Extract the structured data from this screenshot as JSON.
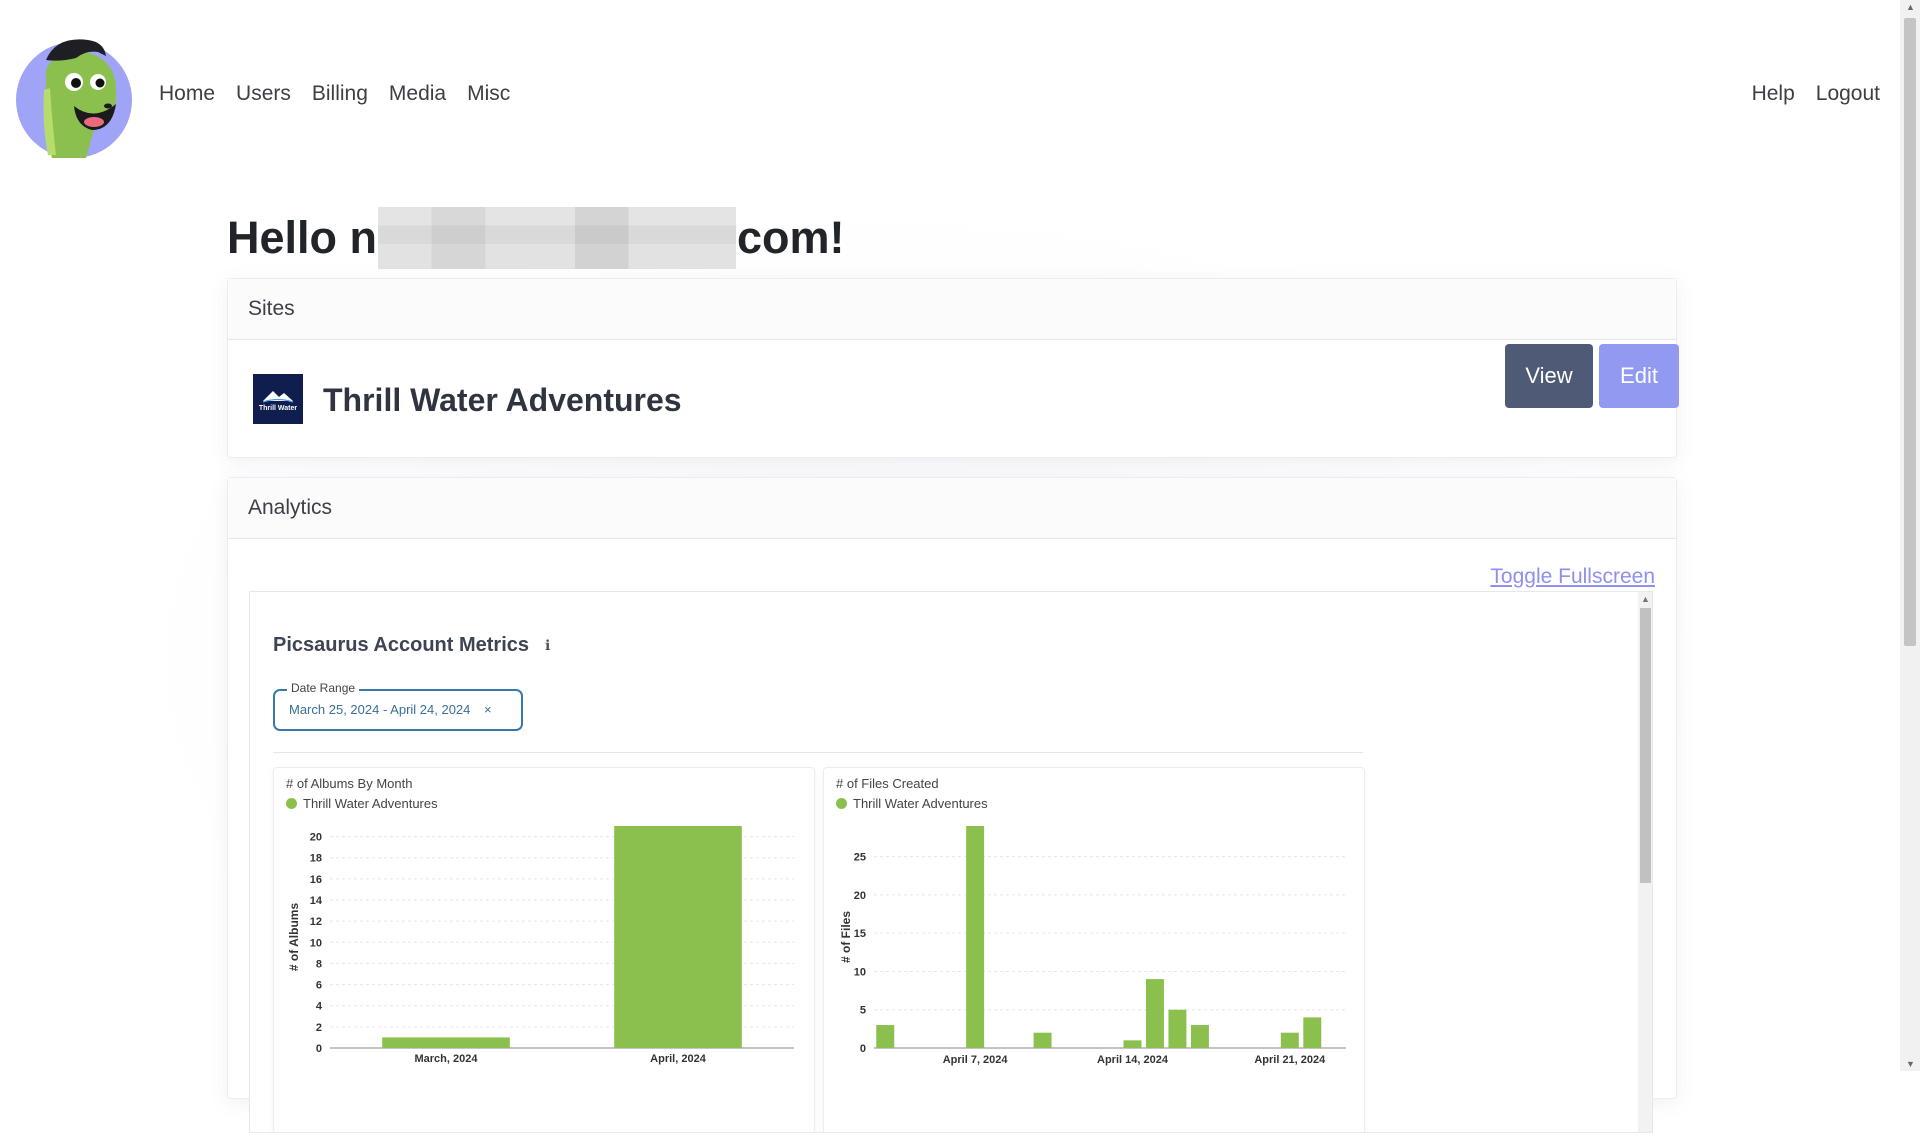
{
  "nav": {
    "left": [
      "Home",
      "Users",
      "Billing",
      "Media",
      "Misc"
    ],
    "right": [
      "Help",
      "Logout"
    ]
  },
  "greeting": {
    "prefix": "Hello n",
    "suffix": "com!"
  },
  "sites": {
    "header": "Sites",
    "items": [
      {
        "name": "Thrill Water Adventures",
        "thumb_text": "Thrill Water",
        "view_label": "View",
        "edit_label": "Edit"
      }
    ]
  },
  "analytics": {
    "header": "Analytics",
    "toggle_label": "Toggle Fullscreen",
    "metrics_title": "Picsaurus Account Metrics",
    "info_icon": "info-icon",
    "date_range": {
      "label": "Date Range",
      "value": "March 25, 2024 - April 24, 2024",
      "clear": "×"
    }
  },
  "colors": {
    "series": "#8bc04e",
    "view_button": "#4f5a76",
    "edit_button": "#9199f1",
    "link": "#8f8ff0"
  },
  "chart_data": [
    {
      "type": "bar",
      "title": "# of Albums By Month",
      "ylabel": "# of Albums",
      "xlabel": "",
      "legend": "top-left",
      "categories": [
        "March, 2024",
        "April, 2024"
      ],
      "series": [
        {
          "name": "Thrill Water Adventures",
          "values": [
            1,
            21
          ]
        }
      ],
      "yticks": [
        0,
        2,
        4,
        6,
        8,
        10,
        12,
        14,
        16,
        18,
        20
      ],
      "ylim": [
        0,
        21
      ],
      "grid": true
    },
    {
      "type": "bar",
      "title": "# of Files Created",
      "ylabel": "# of Files",
      "xlabel": "",
      "legend": "top-left",
      "x": [
        "2024-04-03",
        "2024-04-07",
        "2024-04-10",
        "2024-04-14",
        "2024-04-15",
        "2024-04-16",
        "2024-04-17",
        "2024-04-21",
        "2024-04-22"
      ],
      "xticks": [
        "April 7, 2024",
        "April 14, 2024",
        "April 21, 2024"
      ],
      "series": [
        {
          "name": "Thrill Water Adventures",
          "values": [
            3,
            29,
            2,
            1,
            9,
            5,
            3,
            2,
            4
          ]
        }
      ],
      "yticks": [
        0,
        5,
        10,
        15,
        20,
        25
      ],
      "ylim": [
        0,
        29
      ],
      "grid": true
    }
  ]
}
